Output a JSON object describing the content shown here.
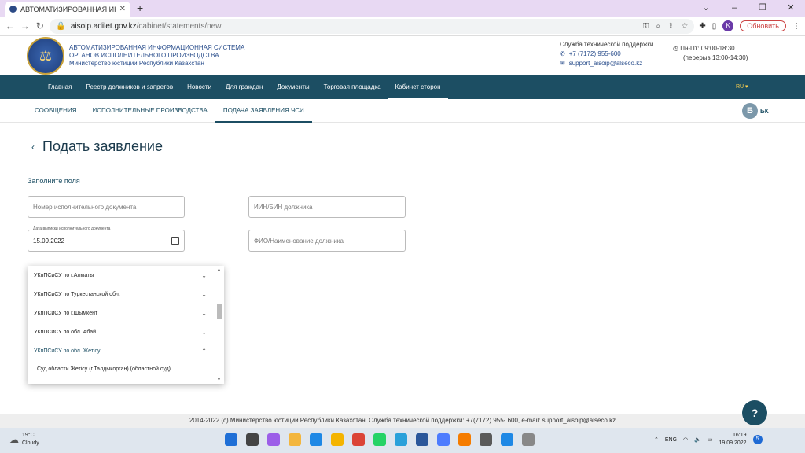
{
  "browser": {
    "tab_title": "АВТОМАТИЗИРОВАННАЯ ИНФ",
    "url_domain": "aisoip.adilet.gov.kz",
    "url_path": "/cabinet/statements/new",
    "update_label": "Обновить",
    "profile_initial": "K"
  },
  "header": {
    "org_line1": "АВТОМАТИЗИРОВАННАЯ ИНФОРМАЦИОННАЯ СИСТЕМА",
    "org_line2": "ОРГАНОВ ИСПОЛНИТЕЛЬНОГО ПРОИЗВОДСТВА",
    "org_line3": "Министерство юстиции Республики Казахстан",
    "support_title": "Служба технической поддержки",
    "support_phone": "+7 (7172) 955-600",
    "support_email": "support_aisoip@alseco.kz",
    "hours_line1": "Пн-Пт: 09:00-18:30",
    "hours_line2": "(перерыв 13:00-14:30)"
  },
  "mainnav": {
    "items": [
      "Главная",
      "Реестр должников и запретов",
      "Новости",
      "Для граждан",
      "Документы",
      "Торговая площадка",
      "Кабинет сторон"
    ],
    "lang": "RU ▾"
  },
  "subnav": {
    "items": [
      "СООБЩЕНИЯ",
      "ИСПОЛНИТЕЛЬНЫЕ ПРОИЗВОДСТВА",
      "ПОДАЧА ЗАЯВЛЕНИЯ ЧСИ"
    ],
    "user_initial": "Б",
    "user_label": "БК"
  },
  "page": {
    "title": "Подать заявление",
    "back": "‹",
    "fill_label": "Заполните поля"
  },
  "form": {
    "doc_number_placeholder": "Номер исполнительного документа",
    "iin_placeholder": "ИИН/БИН должника",
    "date_label": "Дата выписки исполнительного документа",
    "date_value": "15.09.2022",
    "debtor_name_placeholder": "ФИО/Наименование должника"
  },
  "dropdown": {
    "items": [
      {
        "label": "УКпПСиСУ по г.Алматы",
        "chev": "⌄"
      },
      {
        "label": "УКпПСиСУ по Туркестанской обл.",
        "chev": "⌄"
      },
      {
        "label": "УКпПСиСУ по г.Шымкент",
        "chev": "⌄"
      },
      {
        "label": "УКпПСиСУ по обл. Абай",
        "chev": "⌄"
      },
      {
        "label": "УКпПСиСУ по обл. Жетісу",
        "chev": "⌃"
      }
    ],
    "sub_item": "Суд области Жетісу (г.Талдыкорган) (областной суд)"
  },
  "footer": {
    "text": "2014-2022 (с) Министерство юстиции Республики Казахстан. Служба технической поддержки: +7(7172) 955- 600, e-mail: support_aisoip@alseco.kz"
  },
  "help_label": "?",
  "taskbar": {
    "temp": "19°C",
    "weather": "Cloudy",
    "lang": "ENG",
    "time": "16:19",
    "date": "19.09.2022",
    "notif_count": "5",
    "icon_colors": [
      "#1f6fd6",
      "#444",
      "#9c5ee8",
      "#f3b63e",
      "#1e88e5",
      "#f4b400",
      "#db4437",
      "#25d366",
      "#2aa1da",
      "#2b579a",
      "#4d7cfe",
      "#f57c00",
      "#5a5a5a",
      "#1e88e5",
      "#888"
    ]
  }
}
